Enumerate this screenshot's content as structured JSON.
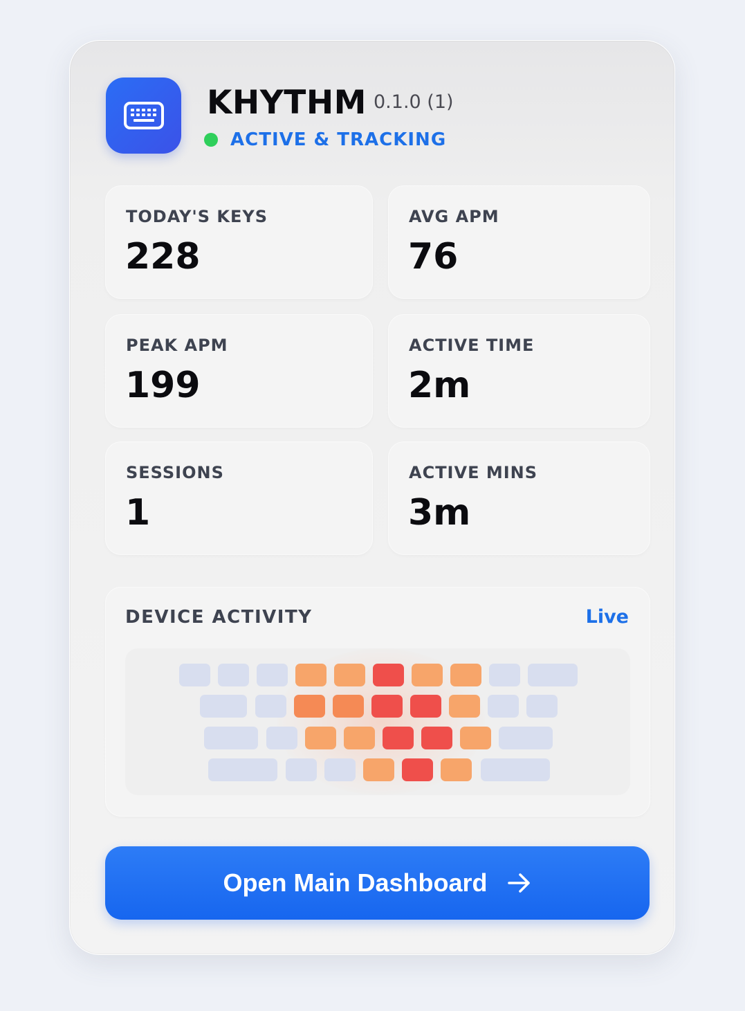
{
  "header": {
    "app_name": "KHYTHM",
    "version": "0.1.0 (1)",
    "status": "ACTIVE & TRACKING",
    "status_color": "#2fcf5b",
    "icon": "keyboard-icon"
  },
  "stats": [
    {
      "label": "TODAY'S KEYS",
      "value": "228"
    },
    {
      "label": "AVG APM",
      "value": "76"
    },
    {
      "label": "PEAK APM",
      "value": "199"
    },
    {
      "label": "ACTIVE TIME",
      "value": "2m"
    },
    {
      "label": "SESSIONS",
      "value": "1"
    },
    {
      "label": "ACTIVE MINS",
      "value": "3m"
    }
  ],
  "activity": {
    "title": "DEVICE ACTIVITY",
    "live_label": "Live",
    "heat_colors": {
      "cool": "#d8deef",
      "warm": "#f7a56a",
      "hot": "#f58a55",
      "red": "#ef4f4b"
    },
    "heatmap_rows": [
      [
        "cool",
        "cool",
        "cool",
        "warm",
        "warm",
        "red",
        "warm",
        "warm",
        "cool",
        "cool"
      ],
      [
        "cool",
        "cool",
        "hot",
        "hot",
        "red",
        "red",
        "warm",
        "cool",
        "cool"
      ],
      [
        "cool",
        "cool",
        "warm",
        "warm",
        "red",
        "red",
        "warm",
        "cool"
      ],
      [
        "cool",
        "cool",
        "cool",
        "warm",
        "red",
        "warm",
        "cool"
      ]
    ]
  },
  "cta": {
    "label": "Open Main Dashboard",
    "icon": "arrow-right-icon",
    "color": "#1d70e8"
  }
}
